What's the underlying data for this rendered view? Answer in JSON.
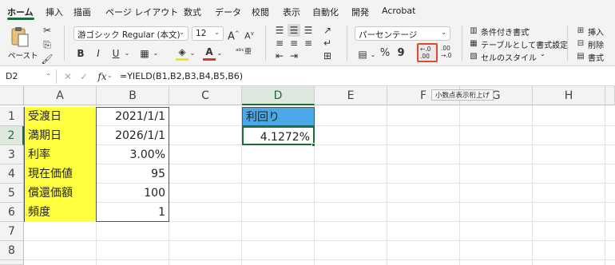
{
  "tabs": [
    "ホーム",
    "挿入",
    "描画",
    "ページ レイアウト",
    "数式",
    "データ",
    "校閲",
    "表示",
    "自動化",
    "開発",
    "Acrobat"
  ],
  "ribbon": {
    "paste_label": "ペースト",
    "font_name": "游ゴシック Regular (本文)",
    "font_size": "12",
    "number_format": "パーセンテージ",
    "increase_decimal_tooltip": "小数点表示桁上げ",
    "conditional_format": "条件付き書式",
    "format_as_table": "テーブルとして書式設定",
    "cell_styles": "セルのスタイル",
    "insert": "挿入",
    "delete": "削除",
    "format": "書式",
    "bold": "B",
    "italic": "I",
    "underline": "U",
    "font_grow": "A",
    "font_shrink": "A",
    "percent": "%",
    "comma": "9",
    "dec_add": ".00",
    "dec_add_top": "←.0",
    "dec_remove_top": ".00",
    "dec_remove": "→.0",
    "accent_color": "#e04a2e",
    "font_color_bar": "#e0332b",
    "fill_color_bar": "#f5e41c"
  },
  "formula_bar": {
    "cell_ref": "D2",
    "fx": "fx",
    "formula": "=YIELD(B1,B2,B3,B4,B5,B6)"
  },
  "grid": {
    "columns": [
      "A",
      "B",
      "C",
      "D",
      "E",
      "F",
      "G",
      "H"
    ],
    "rows": [
      "1",
      "2",
      "3",
      "4",
      "5",
      "6",
      "7",
      "8"
    ],
    "labels": [
      "受渡日",
      "満期日",
      "利率",
      "現在価値",
      "償還価額",
      "頻度"
    ],
    "values": [
      "2021/1/1",
      "2026/1/1",
      "3.00%",
      "95",
      "100",
      "1"
    ],
    "d1_header": "利回り",
    "d2_result": "4.1272%",
    "label_bg": "#ffff40",
    "header_bg": "#4aa8e6",
    "selection_color": "#1e6b3a"
  }
}
